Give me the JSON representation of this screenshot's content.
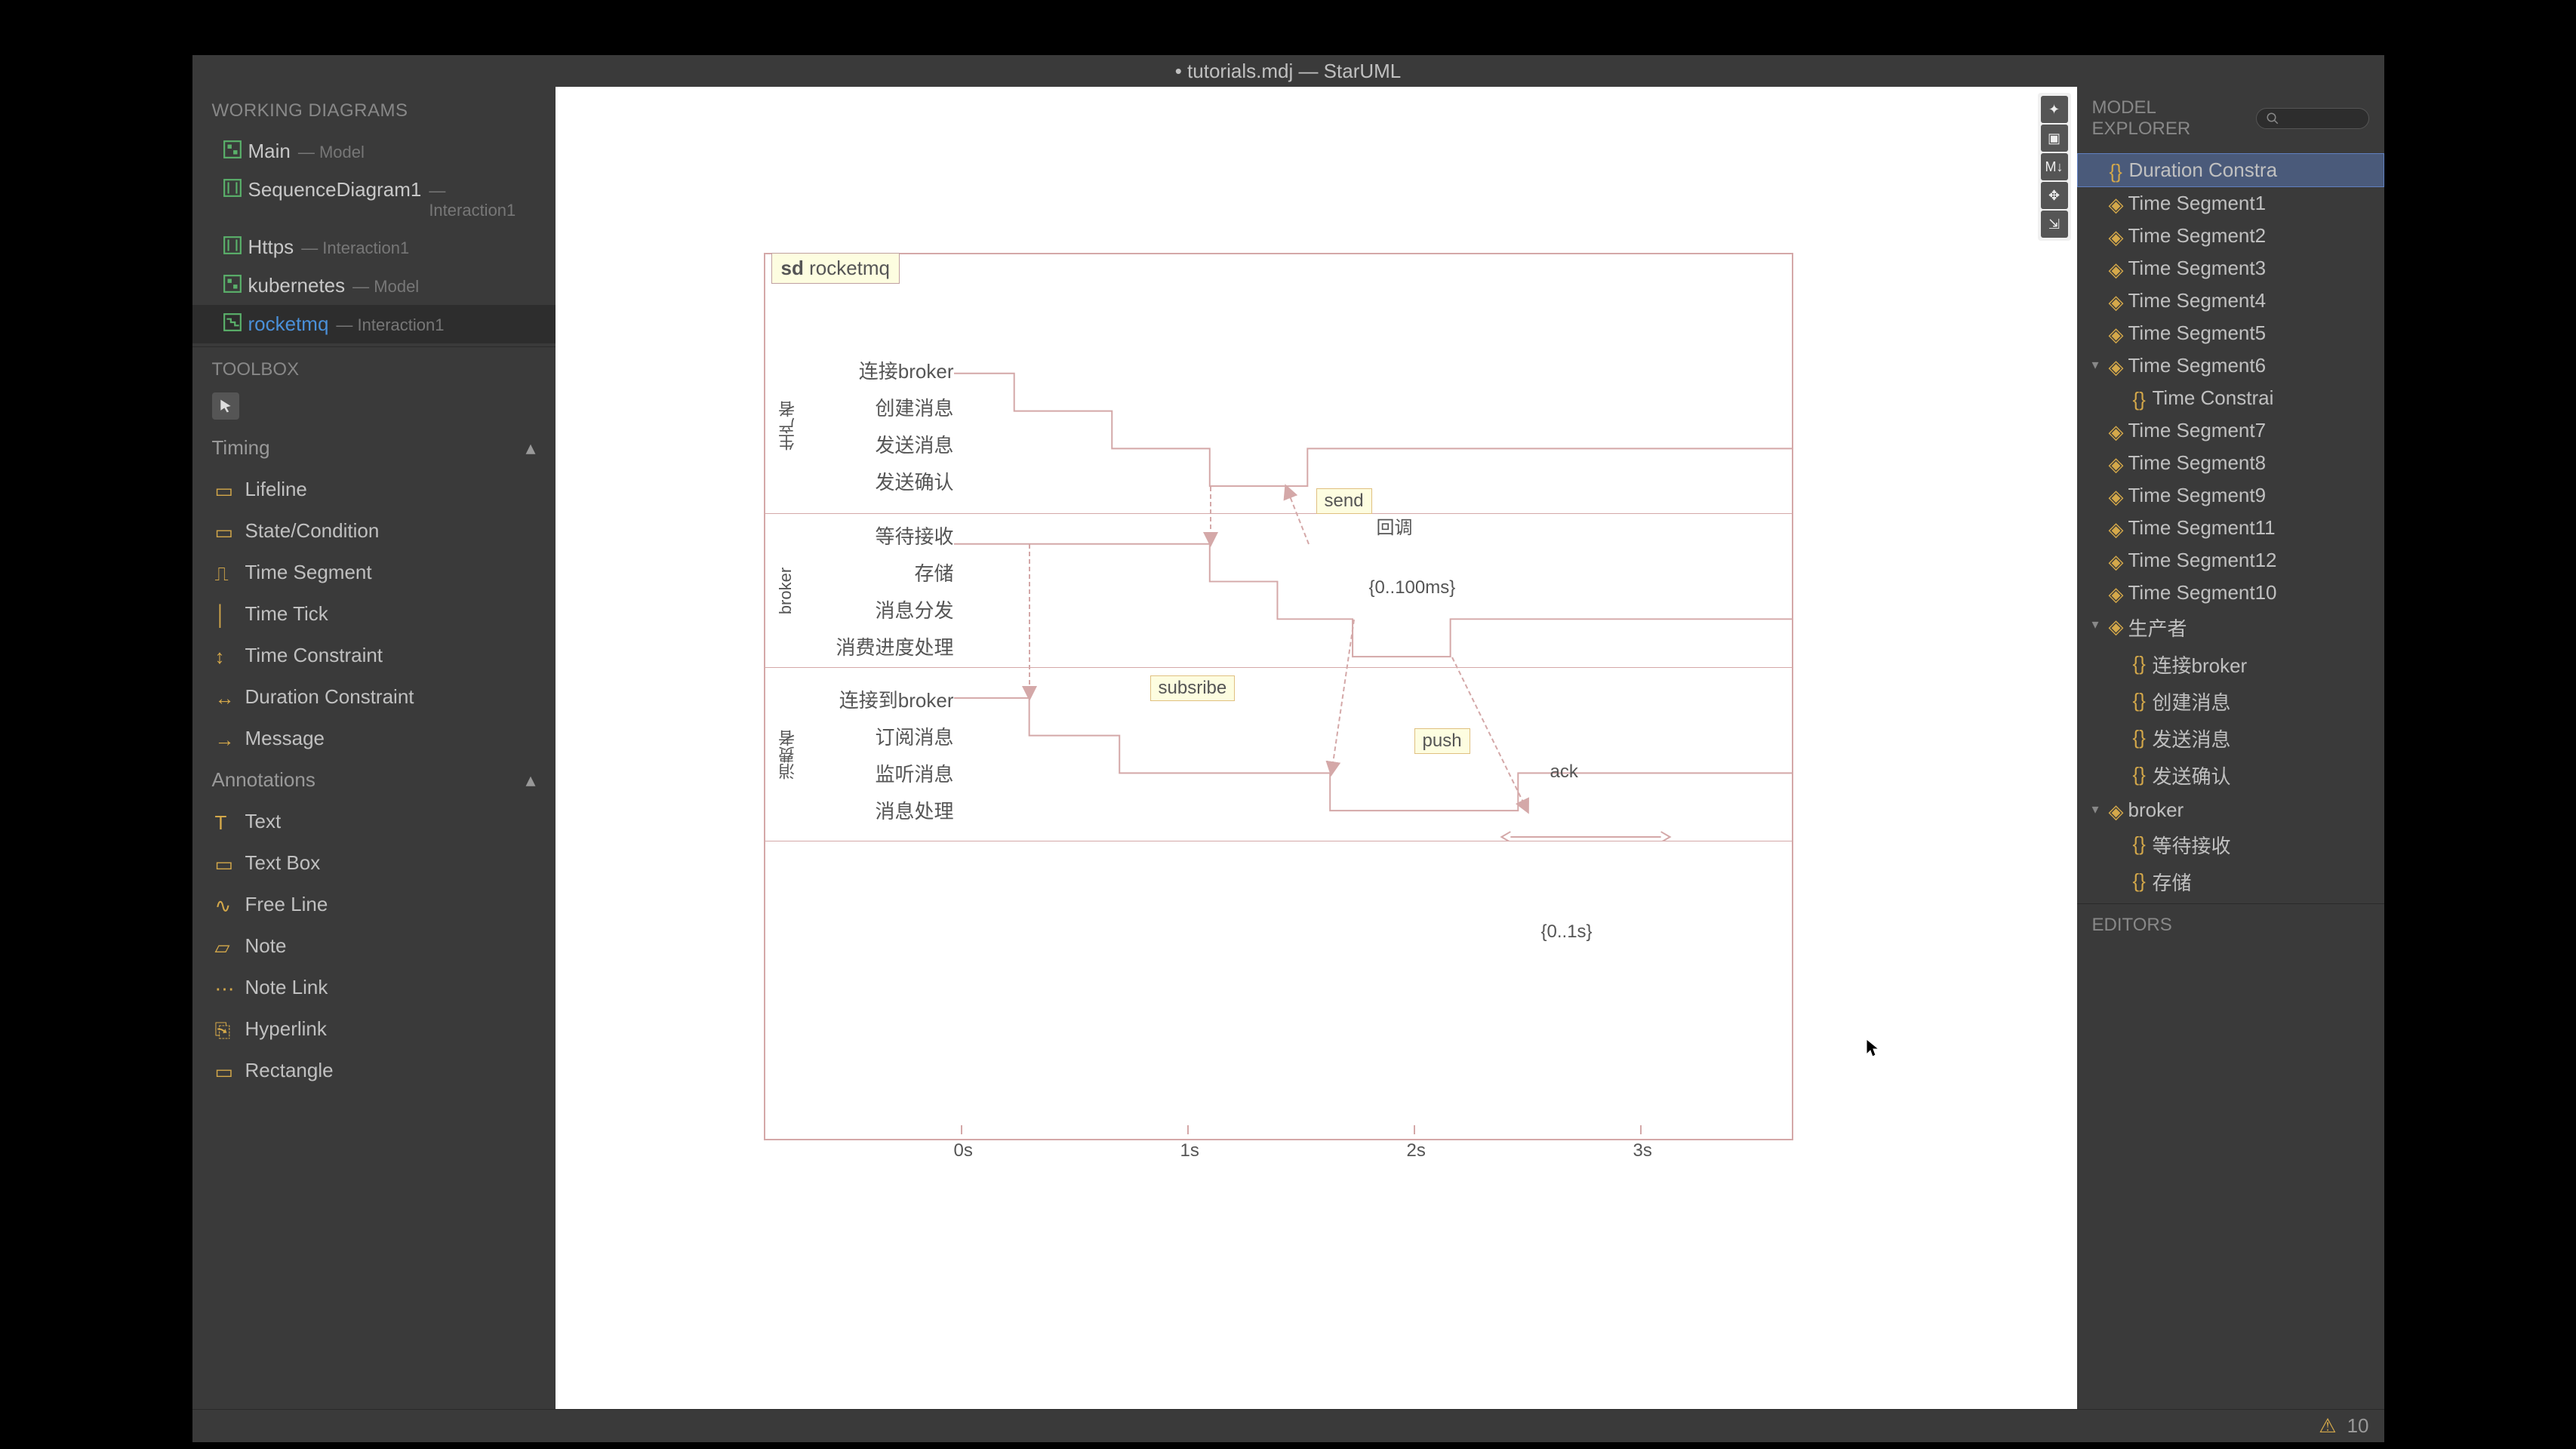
{
  "window": {
    "title": "• tutorials.mdj — StarUML"
  },
  "workingDiagrams": {
    "header": "WORKING DIAGRAMS",
    "items": [
      {
        "name": "Main",
        "sub": "— Model"
      },
      {
        "name": "SequenceDiagram1",
        "sub": "— Interaction1"
      },
      {
        "name": "Https",
        "sub": "— Interaction1"
      },
      {
        "name": "kubernetes",
        "sub": "— Model"
      },
      {
        "name": "rocketmq",
        "sub": "— Interaction1"
      }
    ]
  },
  "toolbox": {
    "header": "TOOLBOX",
    "sections": [
      {
        "label": "Timing",
        "items": [
          "Lifeline",
          "State/Condition",
          "Time Segment",
          "Time Tick",
          "Time Constraint",
          "Duration Constraint",
          "Message"
        ]
      },
      {
        "label": "Annotations",
        "items": [
          "Text",
          "Text Box",
          "Free Line",
          "Note",
          "Note Link",
          "Hyperlink",
          "Rectangle"
        ]
      }
    ]
  },
  "diagram": {
    "sdLabel": "sd",
    "sdName": "rocketmq",
    "lifelines": [
      {
        "title": "生产者",
        "states": [
          "连接broker",
          "创建消息",
          "发送消息",
          "发送确认"
        ]
      },
      {
        "title": "broker",
        "states": [
          "等待接收",
          "存储",
          "消息分发",
          "消费进度处理"
        ]
      },
      {
        "title": "消费者",
        "states": [
          "连接到broker",
          "订阅消息",
          "监听消息",
          "消息处理"
        ]
      }
    ],
    "messages": {
      "send": "send",
      "callback": "回调",
      "subscribe": "subsribe",
      "push": "push",
      "ack": "ack"
    },
    "constraints": {
      "time": "{0..100ms}",
      "duration": "{0..1s}"
    },
    "ticks": [
      "0s",
      "1s",
      "2s",
      "3s"
    ]
  },
  "explorer": {
    "header": "MODEL EXPLORER",
    "searchPlaceholder": "",
    "items": [
      {
        "label": "Duration Constra",
        "selected": true
      },
      {
        "label": "Time Segment1"
      },
      {
        "label": "Time Segment2"
      },
      {
        "label": "Time Segment3"
      },
      {
        "label": "Time Segment4"
      },
      {
        "label": "Time Segment5"
      },
      {
        "label": "Time Segment6",
        "expanded": true,
        "children": [
          {
            "label": "Time Constrai"
          }
        ]
      },
      {
        "label": "Time Segment7"
      },
      {
        "label": "Time Segment8"
      },
      {
        "label": "Time Segment9"
      },
      {
        "label": "Time Segment11"
      },
      {
        "label": "Time Segment12"
      },
      {
        "label": "Time Segment10"
      },
      {
        "label": "生产者",
        "expanded": true,
        "children": [
          {
            "label": "连接broker"
          },
          {
            "label": "创建消息"
          },
          {
            "label": "发送消息"
          },
          {
            "label": "发送确认"
          }
        ]
      },
      {
        "label": "broker",
        "expanded": true,
        "children": [
          {
            "label": "等待接收"
          },
          {
            "label": "存储"
          }
        ]
      }
    ]
  },
  "editors": {
    "header": "EDITORS"
  },
  "status": {
    "zoom": "10"
  }
}
